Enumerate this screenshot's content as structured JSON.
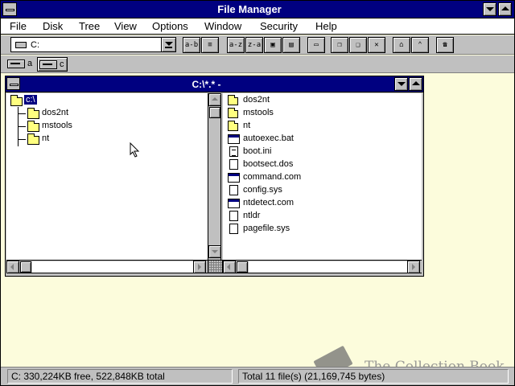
{
  "window": {
    "title": "File Manager"
  },
  "menu": [
    {
      "label": "File"
    },
    {
      "label": "Disk"
    },
    {
      "label": "Tree"
    },
    {
      "label": "View"
    },
    {
      "label": "Options"
    },
    {
      "label": "Window"
    },
    {
      "label": "Security"
    },
    {
      "label": "Help"
    }
  ],
  "toolbar": {
    "drive_value": "C:",
    "buttons": [
      {
        "icon": "tree-dir-icon",
        "glyph": "a-b"
      },
      {
        "icon": "details-icon",
        "glyph": "≡"
      },
      {
        "icon": "sort-name-icon",
        "glyph": "a-z"
      },
      {
        "icon": "sort-type-icon",
        "glyph": "z-a"
      },
      {
        "icon": "sort-size-icon",
        "glyph": "▣"
      },
      {
        "icon": "sort-date-icon",
        "glyph": "▤"
      },
      {
        "icon": "new-window-icon",
        "glyph": "▭"
      },
      {
        "icon": "copy-icon",
        "glyph": "❐"
      },
      {
        "icon": "move-icon",
        "glyph": "❑"
      },
      {
        "icon": "delete-icon",
        "glyph": "✕"
      },
      {
        "icon": "connect-drive-icon",
        "glyph": "⌂"
      },
      {
        "icon": "disconnect-drive-icon",
        "glyph": "⌃"
      },
      {
        "icon": "share-icon",
        "glyph": "☎"
      }
    ]
  },
  "drives": [
    {
      "letter": "a",
      "selected": false
    },
    {
      "letter": "c",
      "selected": true
    }
  ],
  "child_window": {
    "title": "C:\\*.* -"
  },
  "tree": {
    "root": "c:\\",
    "children": [
      "dos2nt",
      "mstools",
      "nt"
    ]
  },
  "files": [
    {
      "name": "dos2nt",
      "type": "folder"
    },
    {
      "name": "mstools",
      "type": "folder"
    },
    {
      "name": "nt",
      "type": "folder"
    },
    {
      "name": "autoexec.bat",
      "type": "app"
    },
    {
      "name": "boot.ini",
      "type": "doc-lines"
    },
    {
      "name": "bootsect.dos",
      "type": "doc"
    },
    {
      "name": "command.com",
      "type": "app"
    },
    {
      "name": "config.sys",
      "type": "doc"
    },
    {
      "name": "ntdetect.com",
      "type": "app"
    },
    {
      "name": "ntldr",
      "type": "doc"
    },
    {
      "name": "pagefile.sys",
      "type": "doc"
    }
  ],
  "status": {
    "free": "C: 330,224KB free,  522,848KB total",
    "total": "Total 11 file(s) (21,169,745 bytes)"
  },
  "watermark": {
    "text": "The Collection Book"
  },
  "colors": {
    "titlebar": "#000080",
    "workspace": "#fcfcdc",
    "face": "#c0c0c0",
    "folder": "#ffff80"
  }
}
